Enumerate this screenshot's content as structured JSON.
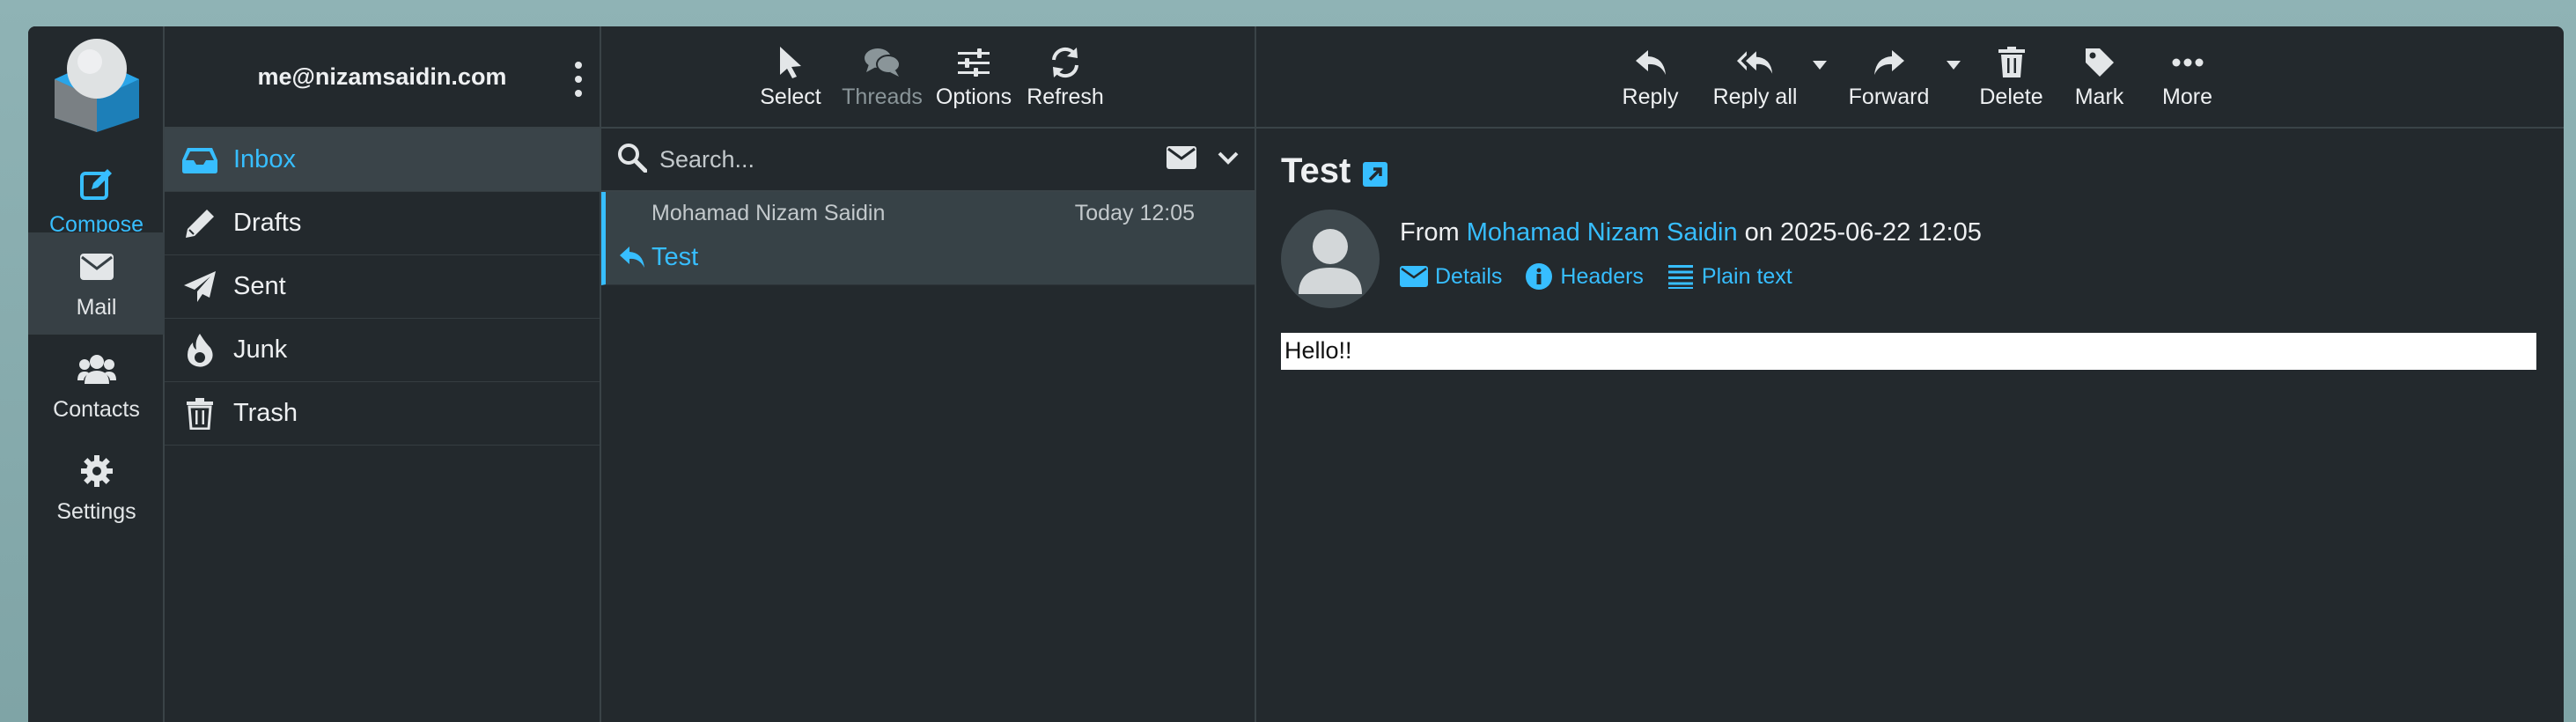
{
  "account": {
    "email": "me@nizamsaidin.com"
  },
  "rail": [
    {
      "label": "Compose",
      "icon": "compose-icon"
    },
    {
      "label": "Mail",
      "icon": "mail-icon"
    },
    {
      "label": "Contacts",
      "icon": "contacts-icon"
    },
    {
      "label": "Settings",
      "icon": "gear-icon"
    }
  ],
  "folders": [
    {
      "label": "Inbox",
      "icon": "inbox-icon"
    },
    {
      "label": "Drafts",
      "icon": "pencil-icon"
    },
    {
      "label": "Sent",
      "icon": "paper-plane-icon"
    },
    {
      "label": "Junk",
      "icon": "fire-icon"
    },
    {
      "label": "Trash",
      "icon": "trash-icon"
    }
  ],
  "list_toolbar": {
    "select": "Select",
    "threads": "Threads",
    "options": "Options",
    "refresh": "Refresh"
  },
  "search": {
    "placeholder": "Search..."
  },
  "messages": [
    {
      "from": "Mohamad Nizam Saidin",
      "date": "Today 12:05",
      "subject": "Test"
    }
  ],
  "reader_toolbar": {
    "reply": "Reply",
    "reply_all": "Reply all",
    "forward": "Forward",
    "delete": "Delete",
    "mark": "Mark",
    "more": "More"
  },
  "message": {
    "subject": "Test",
    "from_prefix": "From",
    "from_name": "Mohamad Nizam Saidin",
    "on_text": "on 2025-06-22 12:05",
    "links": {
      "details": "Details",
      "headers": "Headers",
      "plain_text": "Plain text"
    },
    "body": "Hello!!"
  },
  "colors": {
    "accent": "#37beff",
    "background": "#23292d",
    "selected": "#374247"
  }
}
